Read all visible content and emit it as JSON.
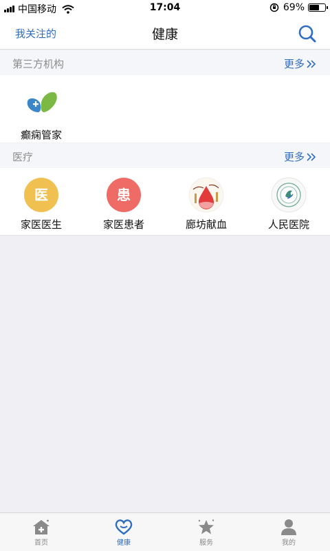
{
  "status_bar": {
    "carrier": "中国移动",
    "time": "17:04",
    "battery_percent": "69%",
    "battery_level": 0.69
  },
  "nav": {
    "left_link": "我关注的",
    "title": "健康",
    "search_icon": "search-icon"
  },
  "sections": [
    {
      "title": "第三方机构",
      "more": "更多",
      "items": [
        {
          "label": "癫痫管家",
          "icon": "epilepsy-manager-icon"
        }
      ]
    },
    {
      "title": "医疗",
      "more": "更多",
      "items": [
        {
          "label": "家医医生",
          "icon": "family-doctor-icon",
          "glyph": "医",
          "color": "#f0c050"
        },
        {
          "label": "家医患者",
          "icon": "family-patient-icon",
          "glyph": "患",
          "color": "#ee6b66"
        },
        {
          "label": "廊坊献血",
          "icon": "blood-donation-icon"
        },
        {
          "label": "人民医院",
          "icon": "peoples-hospital-icon"
        }
      ]
    }
  ],
  "tabs": [
    {
      "label": "首页",
      "icon": "home-icon",
      "active": false
    },
    {
      "label": "健康",
      "icon": "heart-icon",
      "active": true
    },
    {
      "label": "服务",
      "icon": "star-icon",
      "active": false
    },
    {
      "label": "我的",
      "icon": "person-icon",
      "active": false
    }
  ],
  "colors": {
    "accent": "#2f6dc0",
    "background": "#efeff4",
    "section_header": "#f5f6fa"
  }
}
